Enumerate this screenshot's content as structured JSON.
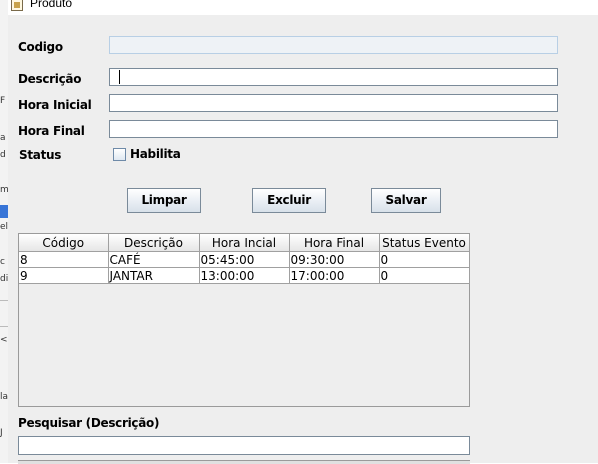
{
  "window": {
    "title": "Produto"
  },
  "background": {
    "fragments": [
      "F",
      "a",
      "d",
      "m",
      "el",
      "c",
      "di",
      "<",
      "J",
      "la"
    ]
  },
  "form": {
    "codigo_label": "Codigo",
    "codigo_value": "",
    "descricao_label": "Descrição",
    "descricao_value": "",
    "hora_inicial_label": "Hora Inicial",
    "hora_inicial_value": "",
    "hora_final_label": "Hora Final",
    "hora_final_value": "",
    "status_label": "Status",
    "habilita_label": "Habilita",
    "habilita_checked": false
  },
  "buttons": {
    "limpar": "Limpar",
    "excluir": "Excluir",
    "salvar": "Salvar"
  },
  "table": {
    "headers": [
      "Código",
      "Descrição",
      "Hora Incial",
      "Hora Final",
      "Status Evento"
    ],
    "rows": [
      [
        "8",
        "CAFÉ",
        "05:45:00",
        "09:30:00",
        "0"
      ],
      [
        "9",
        "JANTAR",
        "13:00:00",
        "17:00:00",
        "0"
      ]
    ]
  },
  "search": {
    "label": "Pesquisar (Descrição)",
    "value": ""
  }
}
